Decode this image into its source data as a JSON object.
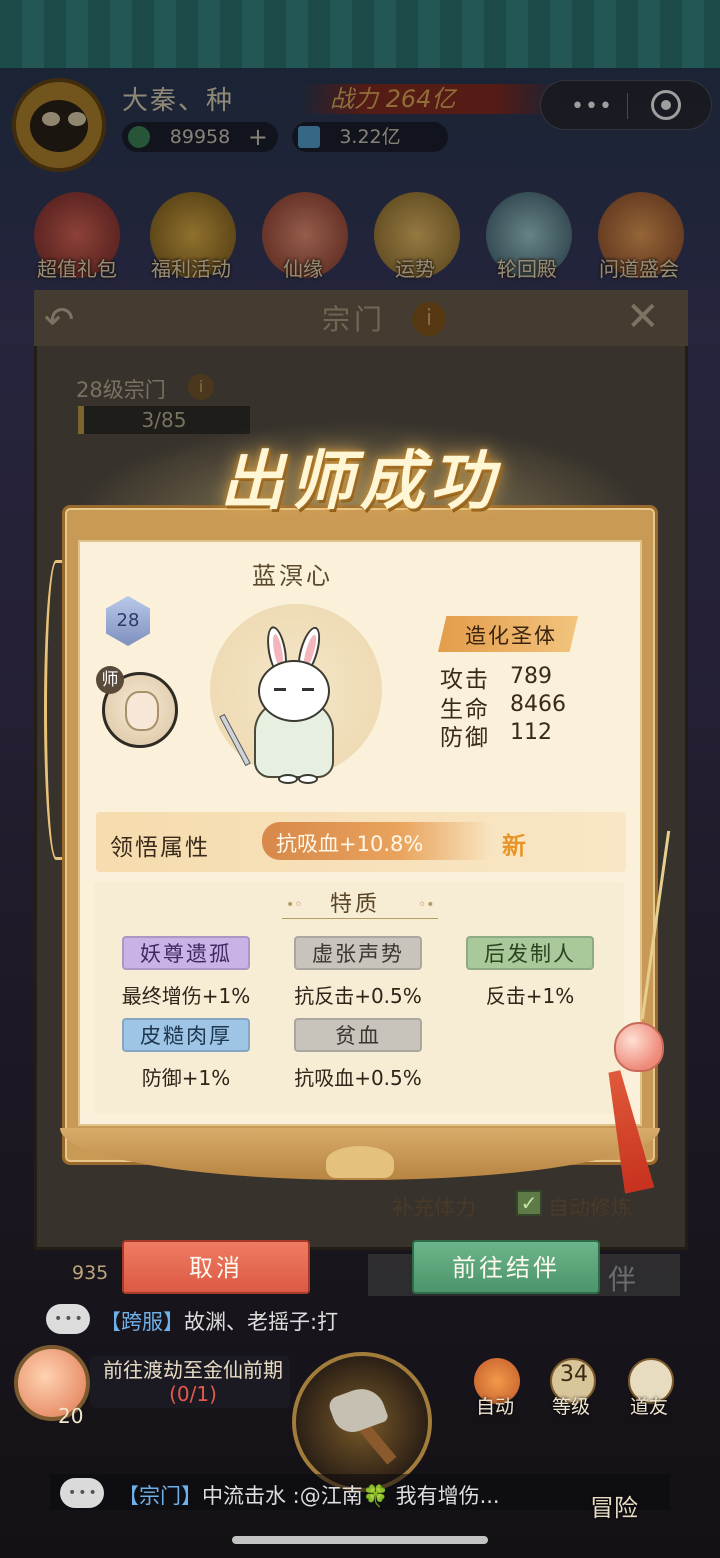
{
  "hud": {
    "player_name": "大秦、种",
    "power": "战力 264亿",
    "currency_green": "89958",
    "currency_plus": "+",
    "currency_blue": "3.22亿",
    "menu_dots": "•••"
  },
  "top_icons": [
    "超值礼包",
    "福利活动",
    "仙缘",
    "运势",
    "轮回殿",
    "问道盛会"
  ],
  "sect_panel": {
    "title": "宗门",
    "info": "i",
    "level": "28级宗门",
    "level_info": "i",
    "exp": "3/85",
    "restore": "补充体力",
    "auto_repair": "自动修炼",
    "back": "↶",
    "close": "✕",
    "background_btn": "伴",
    "num": "935"
  },
  "dialog": {
    "title": "出师成功",
    "disciple_name": "蓝溟心",
    "level": "28",
    "master_tag": "师",
    "physique": "造化圣体",
    "stats": [
      {
        "label": "攻击",
        "value": "789"
      },
      {
        "label": "生命",
        "value": "8466"
      },
      {
        "label": "防御",
        "value": "112"
      }
    ],
    "comprehend_label": "领悟属性",
    "comprehend_value": "抗吸血+10.8%",
    "new_mark": "新",
    "traits_title": "特质",
    "traits": [
      {
        "name": "妖尊遗孤",
        "effect": "最终增伤+1%",
        "color": "#c9b2e6",
        "text_color": "#3e2a62"
      },
      {
        "name": "虚张声势",
        "effect": "抗反击+0.5%",
        "color": "#c8c4bc",
        "text_color": "#3a3630"
      },
      {
        "name": "后发制人",
        "effect": "反击+1%",
        "color": "#a9c99a",
        "text_color": "#2a4420"
      },
      {
        "name": "皮糙肉厚",
        "effect": "防御+1%",
        "color": "#9ec4e6",
        "text_color": "#20384e"
      },
      {
        "name": "贫血",
        "effect": "抗吸血+0.5%",
        "color": "#c8c4bc",
        "text_color": "#3a3630"
      }
    ],
    "cancel": "取消",
    "go_partner": "前往结伴"
  },
  "chat": {
    "bubble": "•••",
    "line1_tag": "【跨服】",
    "line1_text": "故渊、老摇子:打",
    "line2_tag": "【宗门】",
    "line2_text": "中流击水 :@江南🍀 我有增伤..."
  },
  "bottom": {
    "quest": "前往渡劫至金仙前期",
    "quest_progress": "(0/1)",
    "peach_level": "20",
    "auto": "自动",
    "level_num": "34",
    "level_label": "等级",
    "friends": "道友",
    "adventure": "冒险"
  }
}
